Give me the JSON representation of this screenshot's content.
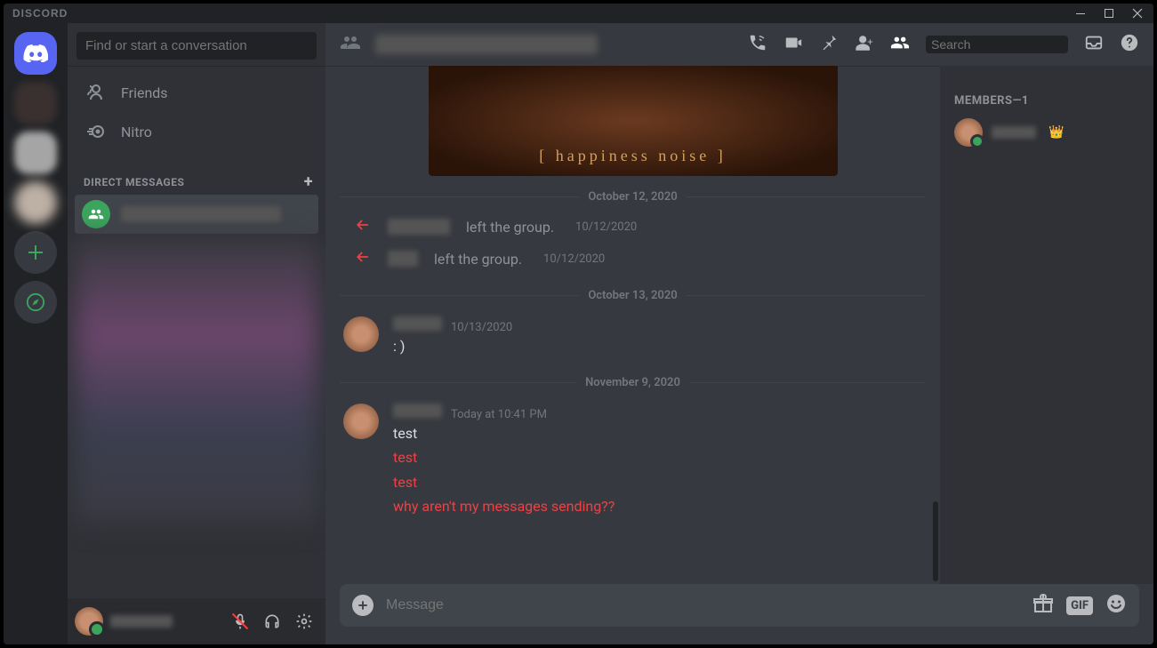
{
  "app_name": "DISCORD",
  "search_placeholder": "Find or start a conversation",
  "nav": {
    "friends": "Friends",
    "nitro": "Nitro"
  },
  "dm_header": "DIRECT MESSAGES",
  "header_search_placeholder": "Search",
  "embed_caption": "[ happiness noise ]",
  "dividers": {
    "d1": "October 12, 2020",
    "d2": "October 13, 2020",
    "d3": "November 9, 2020"
  },
  "system": {
    "left_text": "left the group.",
    "date1": "10/12/2020",
    "date2": "10/12/2020"
  },
  "msg1": {
    "time": "10/13/2020",
    "text": ": )"
  },
  "msg2": {
    "time": "Today at 10:41 PM",
    "line1": "test",
    "line2": "test",
    "line3": "test",
    "line4": "why aren't my messages sending??"
  },
  "compose_placeholder": "Message",
  "gif_label": "GIF",
  "members_header": "MEMBERS—1"
}
